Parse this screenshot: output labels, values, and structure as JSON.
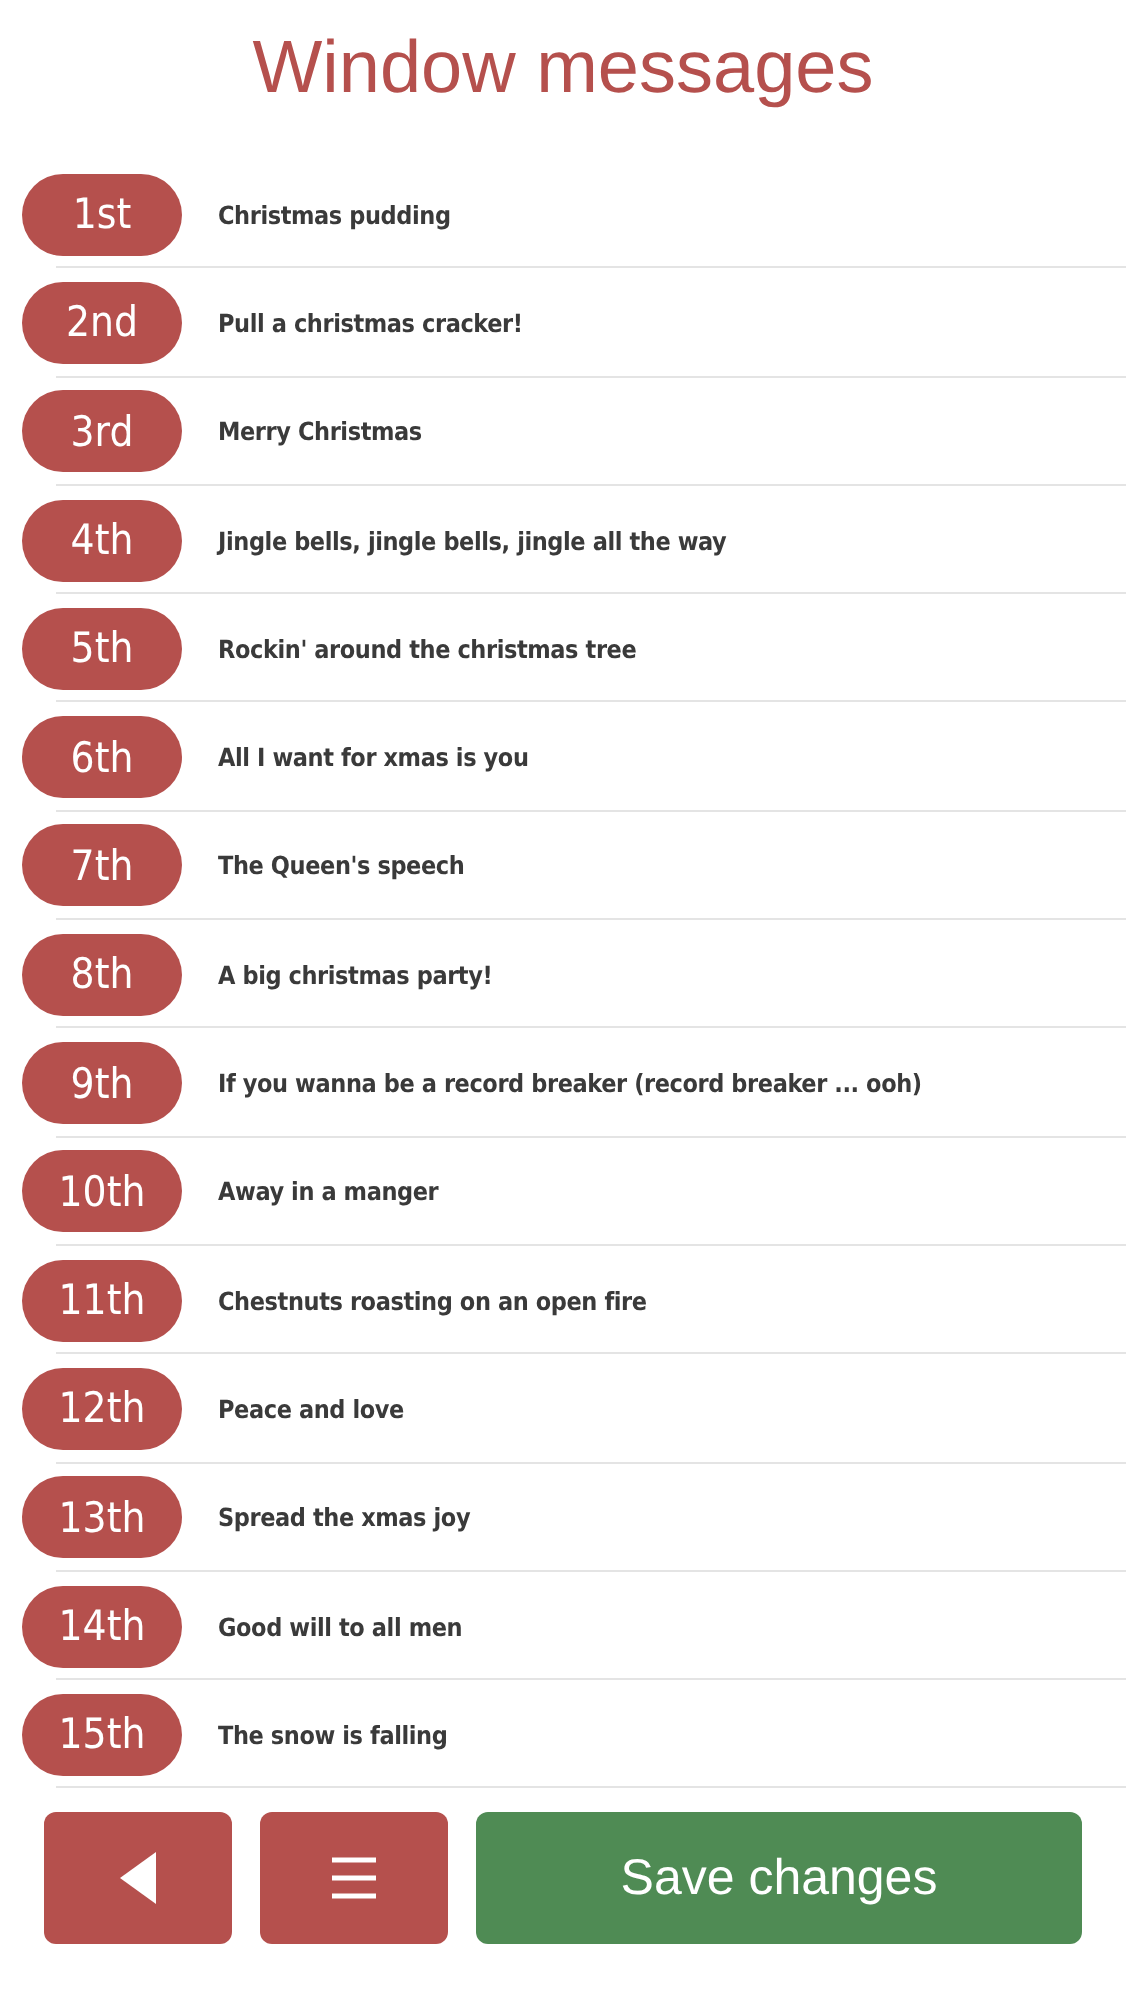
{
  "title": "Window messages",
  "messages": [
    {
      "day": "1st",
      "value": "Christmas pudding"
    },
    {
      "day": "2nd",
      "value": "Pull a christmas cracker!"
    },
    {
      "day": "3rd",
      "value": "Merry Christmas"
    },
    {
      "day": "4th",
      "value": "Jingle bells, jingle bells, jingle all the way"
    },
    {
      "day": "5th",
      "value": "Rockin' around the christmas tree"
    },
    {
      "day": "6th",
      "value": "All I want for xmas is you"
    },
    {
      "day": "7th",
      "value": "The Queen's speech"
    },
    {
      "day": "8th",
      "value": "A big christmas party!"
    },
    {
      "day": "9th",
      "value": "If you wanna be a record breaker (record breaker ... ooh)"
    },
    {
      "day": "10th",
      "value": "Away in a manger"
    },
    {
      "day": "11th",
      "value": "Chestnuts roasting on an open fire"
    },
    {
      "day": "12th",
      "value": "Peace and love"
    },
    {
      "day": "13th",
      "value": "Spread the xmas joy"
    },
    {
      "day": "14th",
      "value": "Good will to all men"
    },
    {
      "day": "15th",
      "value": "The snow is falling"
    }
  ],
  "save_button": "Save changes"
}
